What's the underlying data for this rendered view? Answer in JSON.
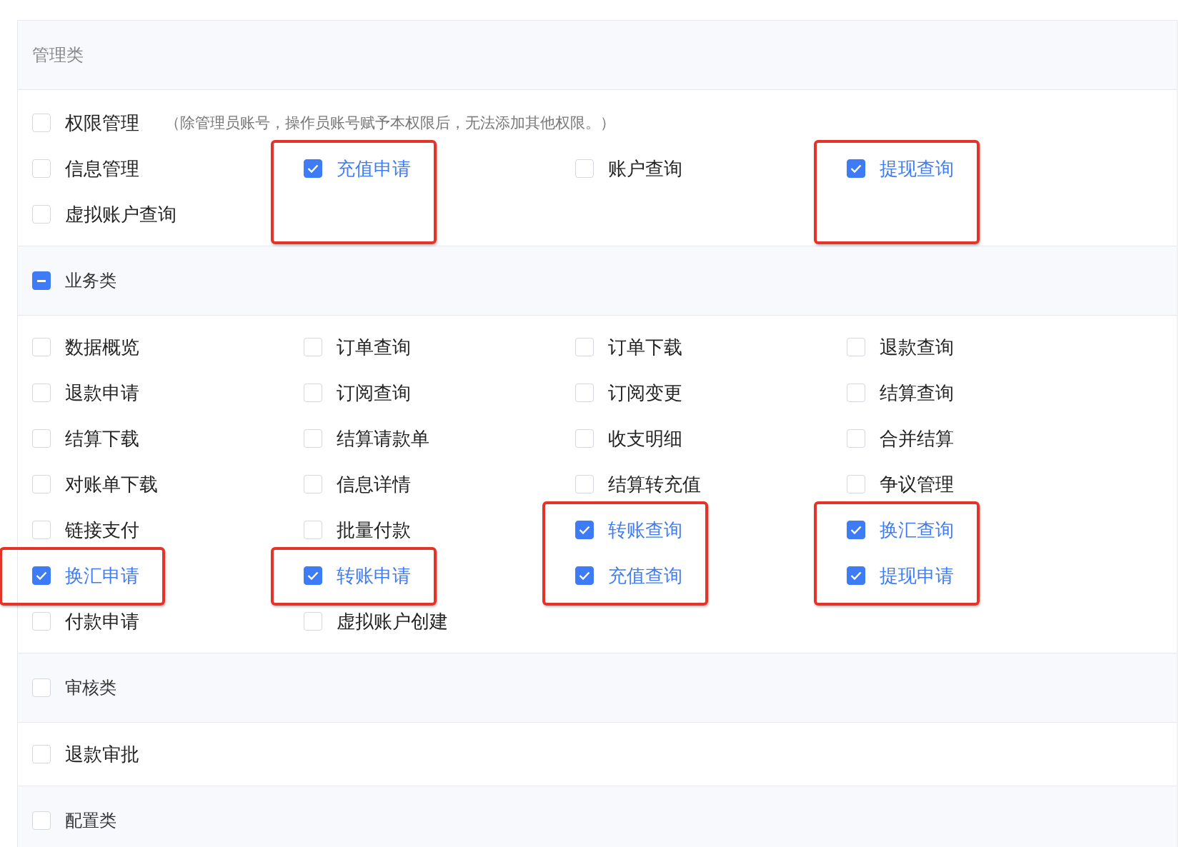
{
  "sections": [
    {
      "title": "管理类",
      "note_item": {
        "label": "权限管理",
        "note": "（除管理员账号，操作员账号赋予本权限后，无法添加其他权限。）",
        "checked": false
      },
      "items": [
        {
          "label": "信息管理",
          "checked": false,
          "highlighted": false
        },
        {
          "label": "充值申请",
          "checked": true,
          "highlighted": true
        },
        {
          "label": "账户查询",
          "checked": false,
          "highlighted": false
        },
        {
          "label": "提现查询",
          "checked": true,
          "highlighted": true
        },
        {
          "label": "虚拟账户查询",
          "checked": false,
          "highlighted": false
        }
      ]
    },
    {
      "title": "业务类",
      "checkbox": {
        "indeterminate": true
      },
      "items": [
        {
          "label": "数据概览",
          "checked": false,
          "highlighted": false
        },
        {
          "label": "订单查询",
          "checked": false,
          "highlighted": false
        },
        {
          "label": "订单下载",
          "checked": false,
          "highlighted": false
        },
        {
          "label": "退款查询",
          "checked": false,
          "highlighted": false
        },
        {
          "label": "退款申请",
          "checked": false,
          "highlighted": false
        },
        {
          "label": "订阅查询",
          "checked": false,
          "highlighted": false
        },
        {
          "label": "订阅变更",
          "checked": false,
          "highlighted": false
        },
        {
          "label": "结算查询",
          "checked": false,
          "highlighted": false
        },
        {
          "label": "结算下载",
          "checked": false,
          "highlighted": false
        },
        {
          "label": "结算请款单",
          "checked": false,
          "highlighted": false
        },
        {
          "label": "收支明细",
          "checked": false,
          "highlighted": false
        },
        {
          "label": "合并结算",
          "checked": false,
          "highlighted": false
        },
        {
          "label": "对账单下载",
          "checked": false,
          "highlighted": false
        },
        {
          "label": "信息详情",
          "checked": false,
          "highlighted": false
        },
        {
          "label": "结算转充值",
          "checked": false,
          "highlighted": false
        },
        {
          "label": "争议管理",
          "checked": false,
          "highlighted": false
        },
        {
          "label": "链接支付",
          "checked": false,
          "highlighted": false
        },
        {
          "label": "批量付款",
          "checked": false,
          "highlighted": false
        },
        {
          "label": "转账查询",
          "checked": true,
          "highlighted": true
        },
        {
          "label": "换汇查询",
          "checked": true,
          "highlighted": true
        },
        {
          "label": "换汇申请",
          "checked": true,
          "highlighted": true
        },
        {
          "label": "转账申请",
          "checked": true,
          "highlighted": true
        },
        {
          "label": "充值查询",
          "checked": true,
          "highlighted": true
        },
        {
          "label": "提现申请",
          "checked": true,
          "highlighted": true
        },
        {
          "label": "付款申请",
          "checked": false,
          "highlighted": false
        },
        {
          "label": "虚拟账户创建",
          "checked": false,
          "highlighted": false
        }
      ]
    },
    {
      "title": "审核类",
      "checkbox": {
        "indeterminate": false
      },
      "items": [
        {
          "label": "退款审批",
          "checked": false,
          "highlighted": false
        }
      ]
    },
    {
      "title": "配置类",
      "checkbox": {
        "indeterminate": false
      }
    }
  ]
}
